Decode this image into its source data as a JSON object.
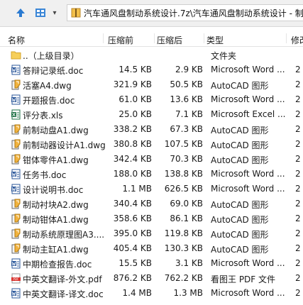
{
  "toolbar": {
    "address": "汽车通风盘制动系统设计.7z\\汽车通风盘制动系统设计 - 制"
  },
  "header": {
    "name": "名称",
    "packed": "压缩前",
    "size": "压缩后",
    "type": "类型",
    "modified": "修改"
  },
  "files": [
    {
      "icon": "folder-icon",
      "name": "..（上级目录）",
      "packed": "",
      "size": "",
      "type": "文件夹",
      "mod": ""
    },
    {
      "icon": "word-doc-icon",
      "name": "答辩记录纸.doc",
      "packed": "14.5 KB",
      "size": "2.9 KB",
      "type": "Microsoft Word ...",
      "mod": "2"
    },
    {
      "icon": "dwg-file-icon",
      "name": "活塞A4.dwg",
      "packed": "321.9 KB",
      "size": "50.5 KB",
      "type": "AutoCAD 图形",
      "mod": "2"
    },
    {
      "icon": "word-doc-icon",
      "name": "开题报告.doc",
      "packed": "61.0 KB",
      "size": "13.6 KB",
      "type": "Microsoft Word ...",
      "mod": "2"
    },
    {
      "icon": "excel-xls-icon",
      "name": "评分表.xls",
      "packed": "25.0 KB",
      "size": "7.1 KB",
      "type": "Microsoft Excel ...",
      "mod": "2"
    },
    {
      "icon": "dwg-file-icon",
      "name": "前制动盘A1.dwg",
      "packed": "338.2 KB",
      "size": "67.3 KB",
      "type": "AutoCAD 图形",
      "mod": "2"
    },
    {
      "icon": "dwg-file-icon",
      "name": "前制动器设计A1.dwg",
      "packed": "380.8 KB",
      "size": "107.5 KB",
      "type": "AutoCAD 图形",
      "mod": "2"
    },
    {
      "icon": "dwg-file-icon",
      "name": "钳体零件A1.dwg",
      "packed": "342.4 KB",
      "size": "70.3 KB",
      "type": "AutoCAD 图形",
      "mod": "2"
    },
    {
      "icon": "word-doc-icon",
      "name": "任务书.doc",
      "packed": "188.0 KB",
      "size": "138.8 KB",
      "type": "Microsoft Word ...",
      "mod": "2"
    },
    {
      "icon": "word-doc-icon",
      "name": "设计说明书.doc",
      "packed": "1.1 MB",
      "size": "626.5 KB",
      "type": "Microsoft Word ...",
      "mod": "2"
    },
    {
      "icon": "dwg-file-icon",
      "name": "制动衬块A2.dwg",
      "packed": "340.4 KB",
      "size": "69.0 KB",
      "type": "AutoCAD 图形",
      "mod": "2"
    },
    {
      "icon": "dwg-file-icon",
      "name": "制动钳体A1.dwg",
      "packed": "358.6 KB",
      "size": "86.1 KB",
      "type": "AutoCAD 图形",
      "mod": "2"
    },
    {
      "icon": "dwg-file-icon",
      "name": "制动系统原理图A3....",
      "packed": "395.0 KB",
      "size": "119.8 KB",
      "type": "AutoCAD 图形",
      "mod": "2"
    },
    {
      "icon": "dwg-file-icon",
      "name": "制动主缸A1.dwg",
      "packed": "405.4 KB",
      "size": "130.3 KB",
      "type": "AutoCAD 图形",
      "mod": "2"
    },
    {
      "icon": "word-doc-icon",
      "name": "中期检查报告.doc",
      "packed": "15.5 KB",
      "size": "3.1 KB",
      "type": "Microsoft Word ...",
      "mod": "2"
    },
    {
      "icon": "pdf-file-icon",
      "name": "中英文翻译-外文.pdf",
      "packed": "876.2 KB",
      "size": "762.2 KB",
      "type": "看图王 PDF 文件",
      "mod": "2"
    },
    {
      "icon": "word-doc-icon",
      "name": "中英文翻译-译文.doc",
      "packed": "1.4 MB",
      "size": "1.3 MB",
      "type": "Microsoft Word ...",
      "mod": "2"
    }
  ]
}
